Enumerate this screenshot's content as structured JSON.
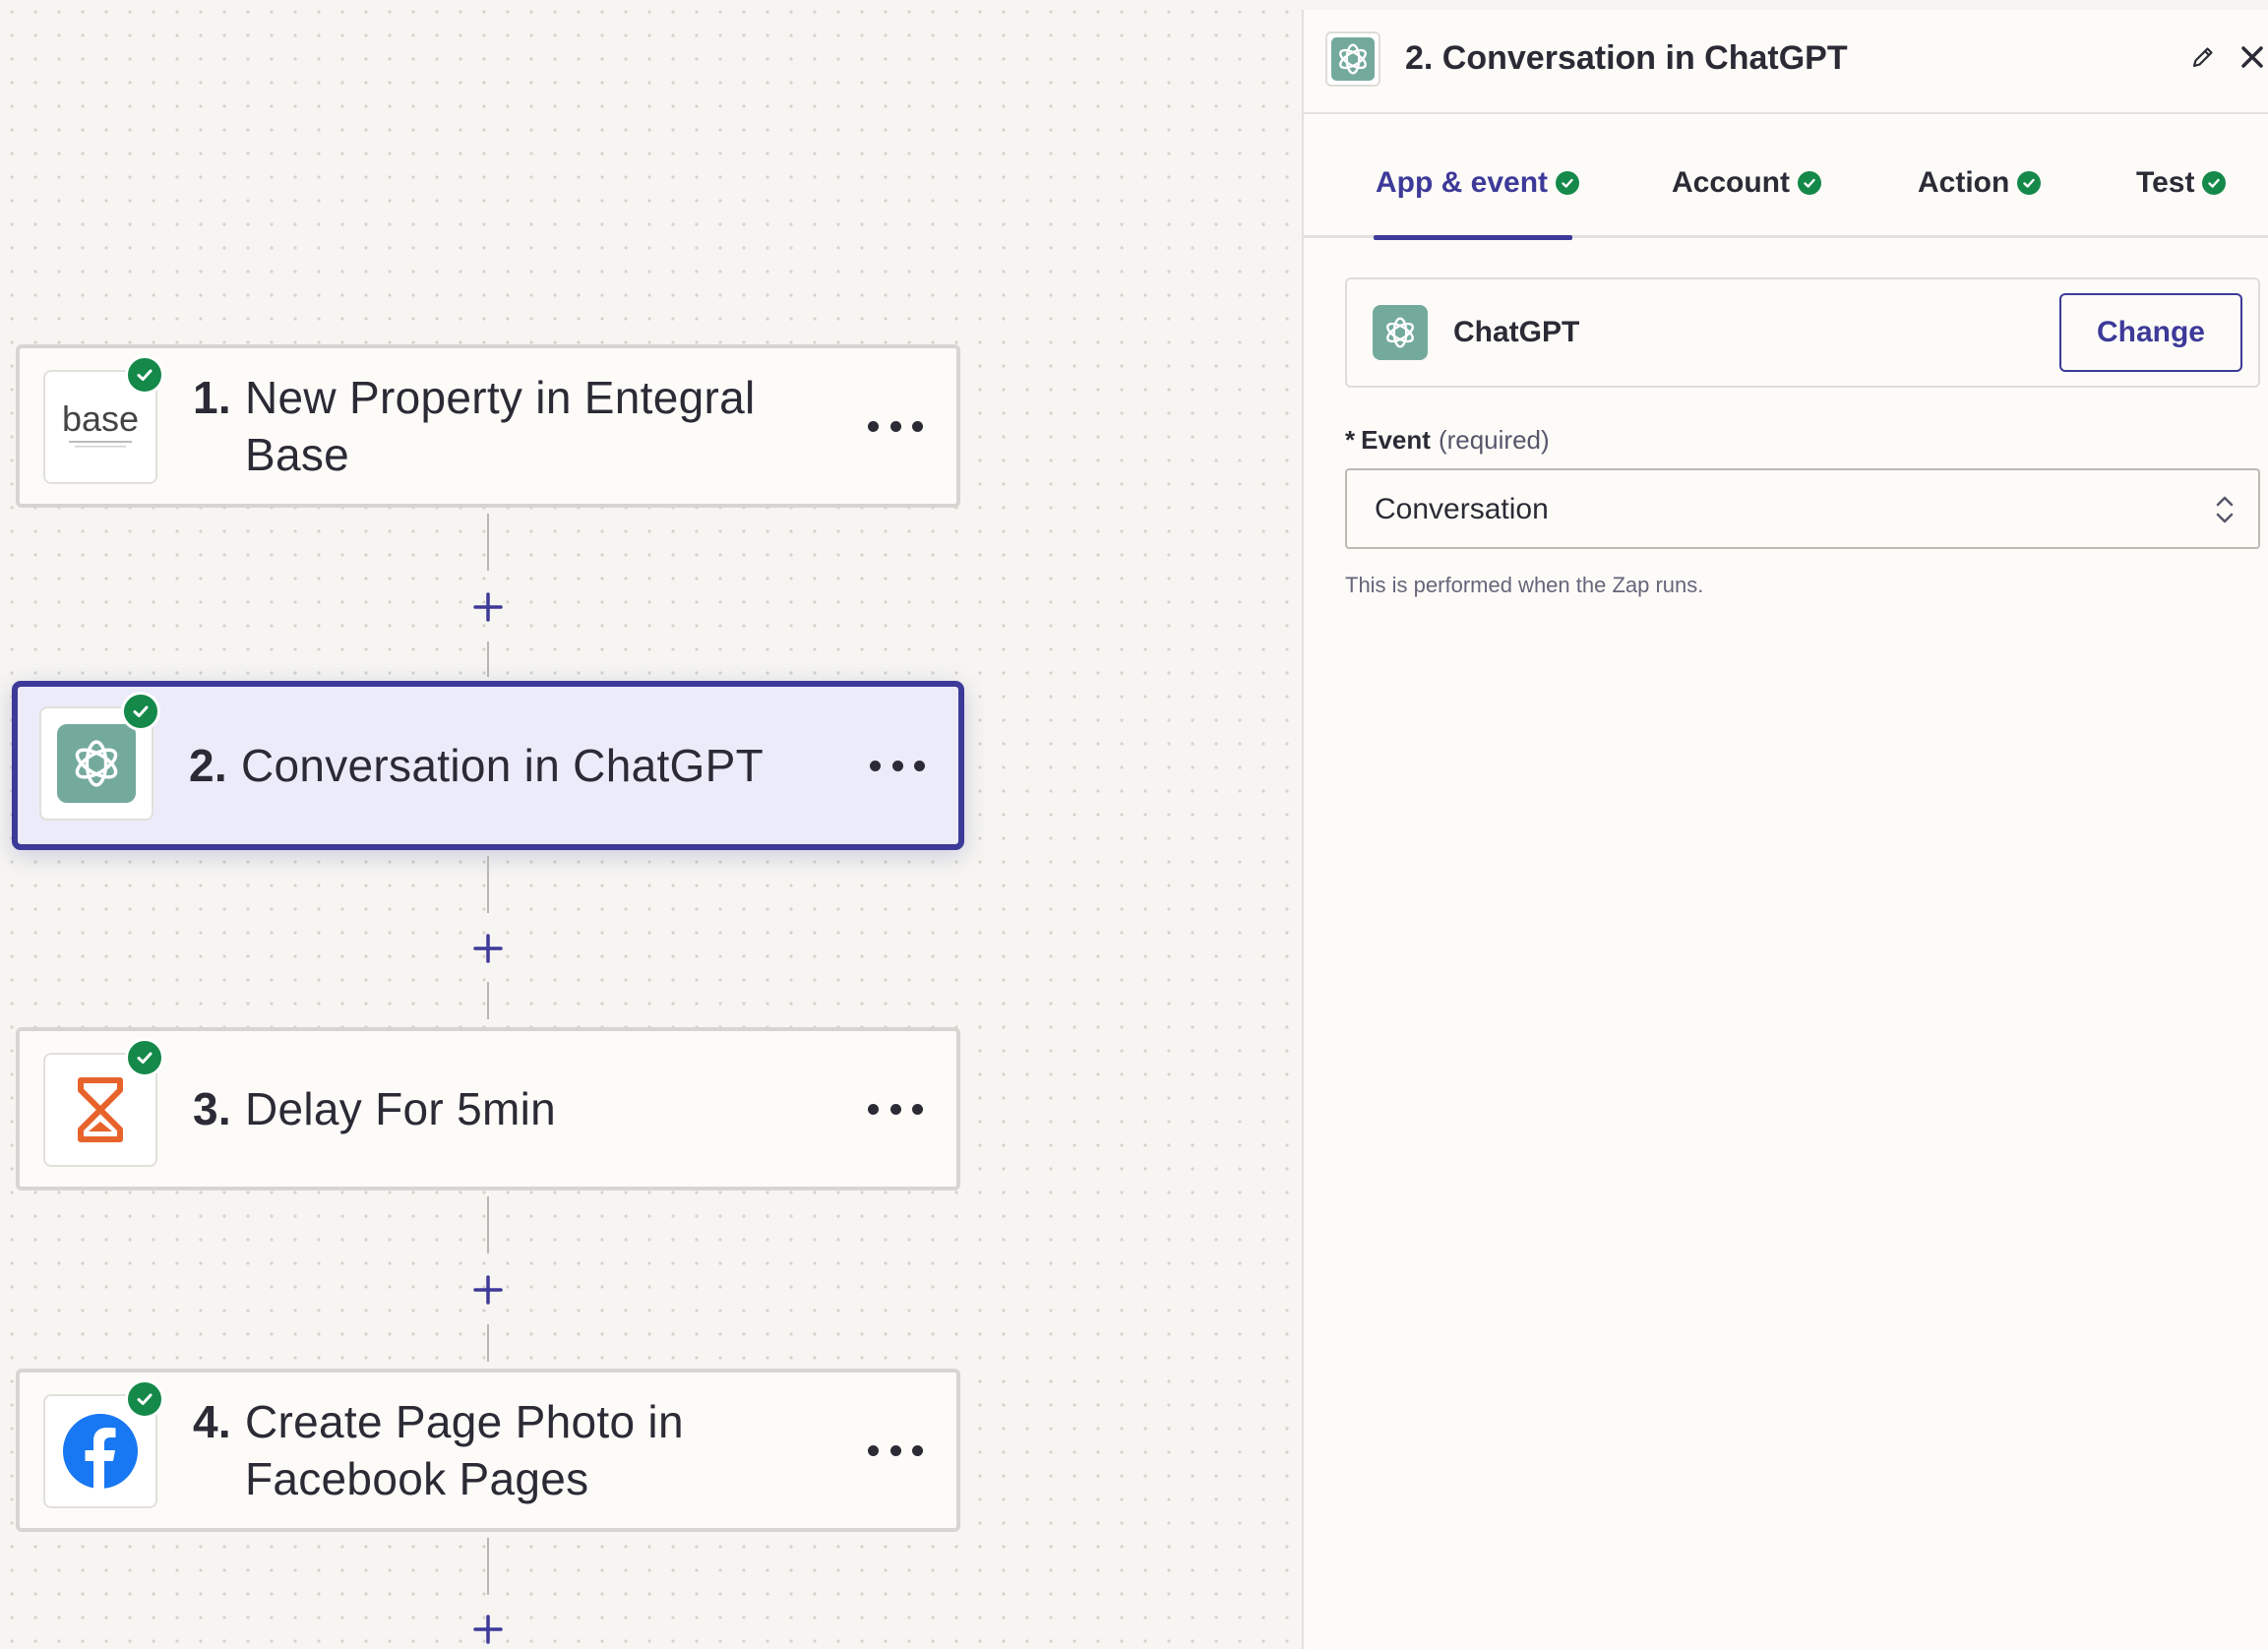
{
  "canvas": {
    "steps": [
      {
        "number": "1.",
        "name": "New Property in Entegral Base",
        "icon": "base-logo-icon",
        "logo_text": "base",
        "status": "complete",
        "selected": false
      },
      {
        "number": "2.",
        "name": "Conversation in ChatGPT",
        "icon": "chatgpt-icon",
        "status": "complete",
        "selected": true
      },
      {
        "number": "3.",
        "name": "Delay For 5min",
        "icon": "hourglass-icon",
        "status": "complete",
        "selected": false
      },
      {
        "number": "4.",
        "name": "Create Page Photo in Facebook Pages",
        "icon": "facebook-icon",
        "status": "complete",
        "selected": false
      }
    ]
  },
  "panel": {
    "title": "2. Conversation in ChatGPT",
    "tabs": [
      {
        "label": "App & event",
        "active": true,
        "complete": true
      },
      {
        "label": "Account",
        "active": false,
        "complete": true
      },
      {
        "label": "Action",
        "active": false,
        "complete": true
      },
      {
        "label": "Test",
        "active": false,
        "complete": true
      }
    ],
    "app": {
      "name": "ChatGPT",
      "change_label": "Change"
    },
    "event": {
      "required_marker": "*",
      "label": "Event",
      "required_text": "(required)",
      "value": "Conversation",
      "help": "This is performed when the Zap runs."
    }
  },
  "colors": {
    "accent": "#3d3a99",
    "success": "#14894a",
    "chatgpt": "#74aa9c",
    "facebook": "#1877f2",
    "delay": "#e8632b"
  }
}
